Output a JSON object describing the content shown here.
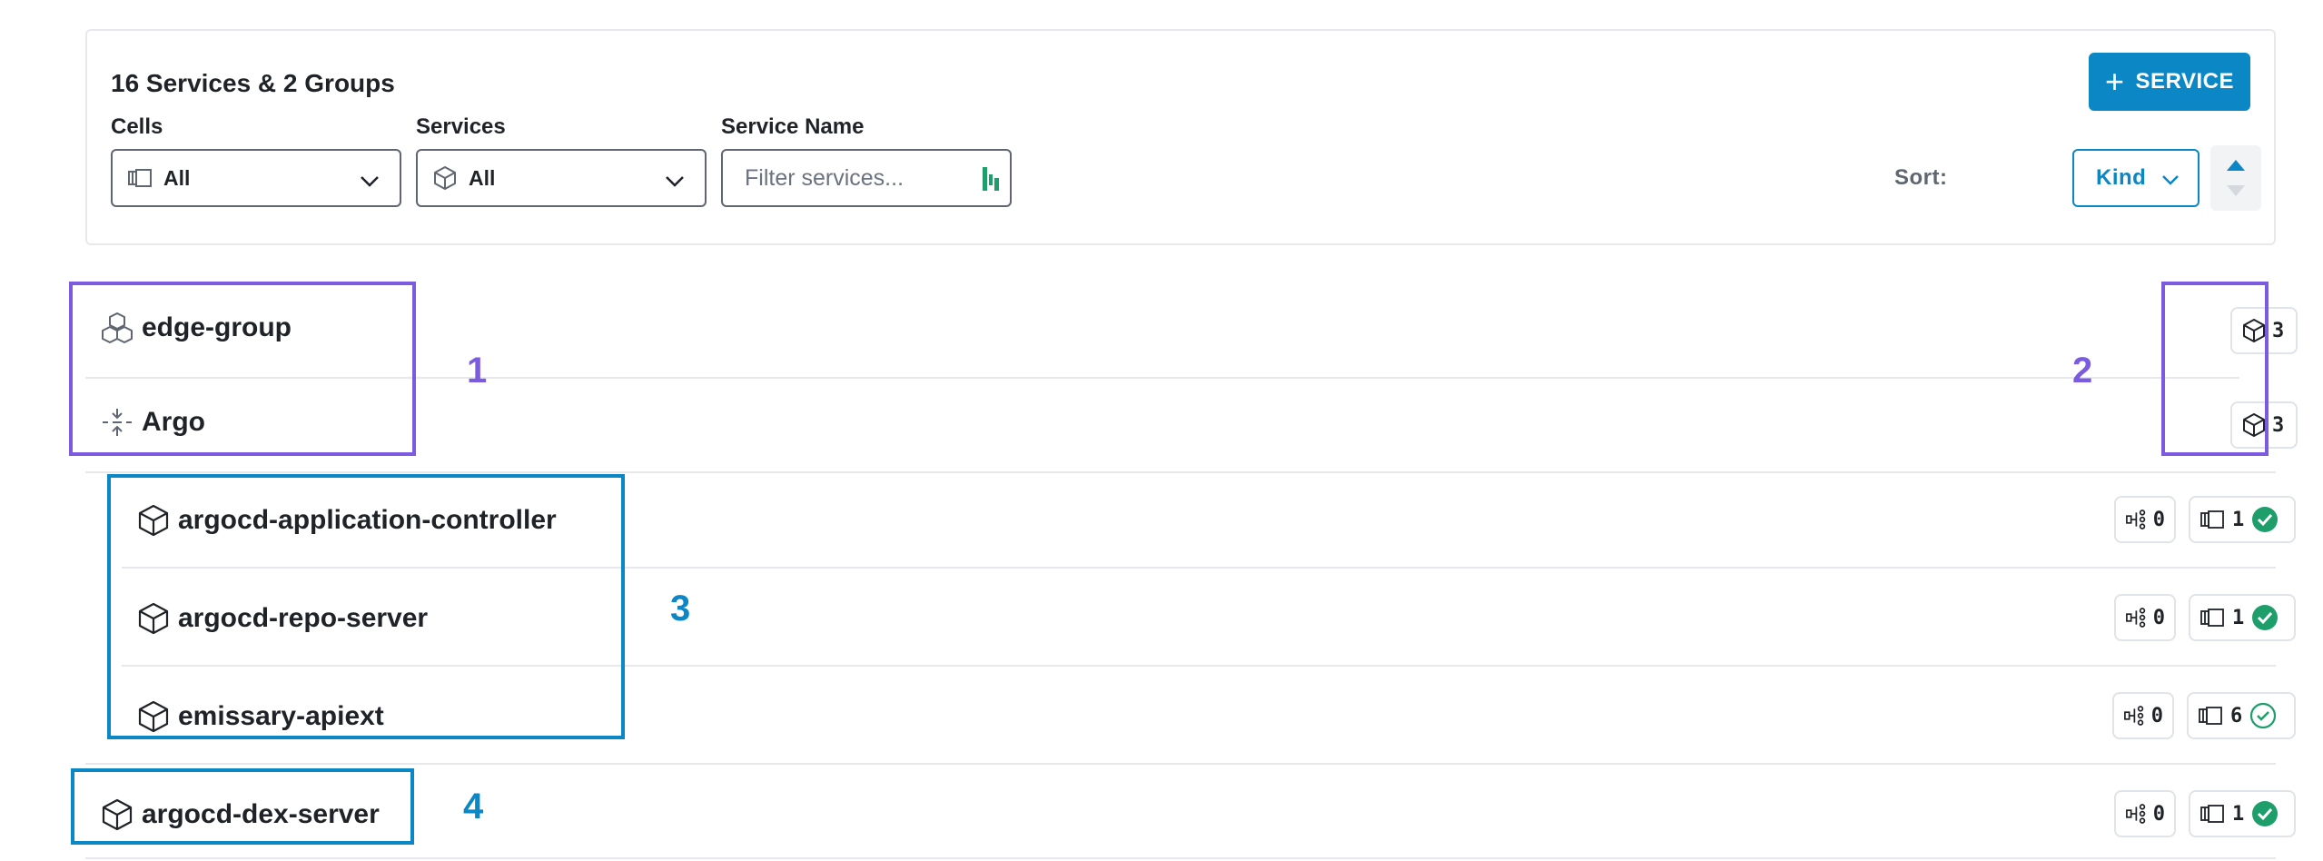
{
  "header": {
    "title": "16 Services & 2 Groups",
    "add_service_label": "SERVICE"
  },
  "filters": {
    "cells": {
      "label": "Cells",
      "value": "All"
    },
    "services": {
      "label": "Services",
      "value": "All"
    },
    "service_name": {
      "label": "Service Name",
      "placeholder": "Filter services..."
    }
  },
  "sort": {
    "label": "Sort:",
    "value": "Kind"
  },
  "groups": [
    {
      "name": "edge-group",
      "count": "3"
    },
    {
      "name": "Argo",
      "count": "3"
    }
  ],
  "services": [
    {
      "name": "argocd-application-controller",
      "connections": "0",
      "cells": "1",
      "status": "healthy-filled"
    },
    {
      "name": "argocd-repo-server",
      "connections": "0",
      "cells": "1",
      "status": "healthy-filled"
    },
    {
      "name": "emissary-apiext",
      "connections": "0",
      "cells": "6",
      "status": "healthy-outline"
    },
    {
      "name": "argocd-dex-server",
      "connections": "0",
      "cells": "1",
      "status": "healthy-filled"
    }
  ],
  "annotations": [
    "1",
    "2",
    "3",
    "4"
  ],
  "colors": {
    "accent": "#0a87c4",
    "annotation_purple": "#7b5ce0",
    "annotation_blue": "#0a87c4",
    "status_green": "#1e9e6a"
  }
}
